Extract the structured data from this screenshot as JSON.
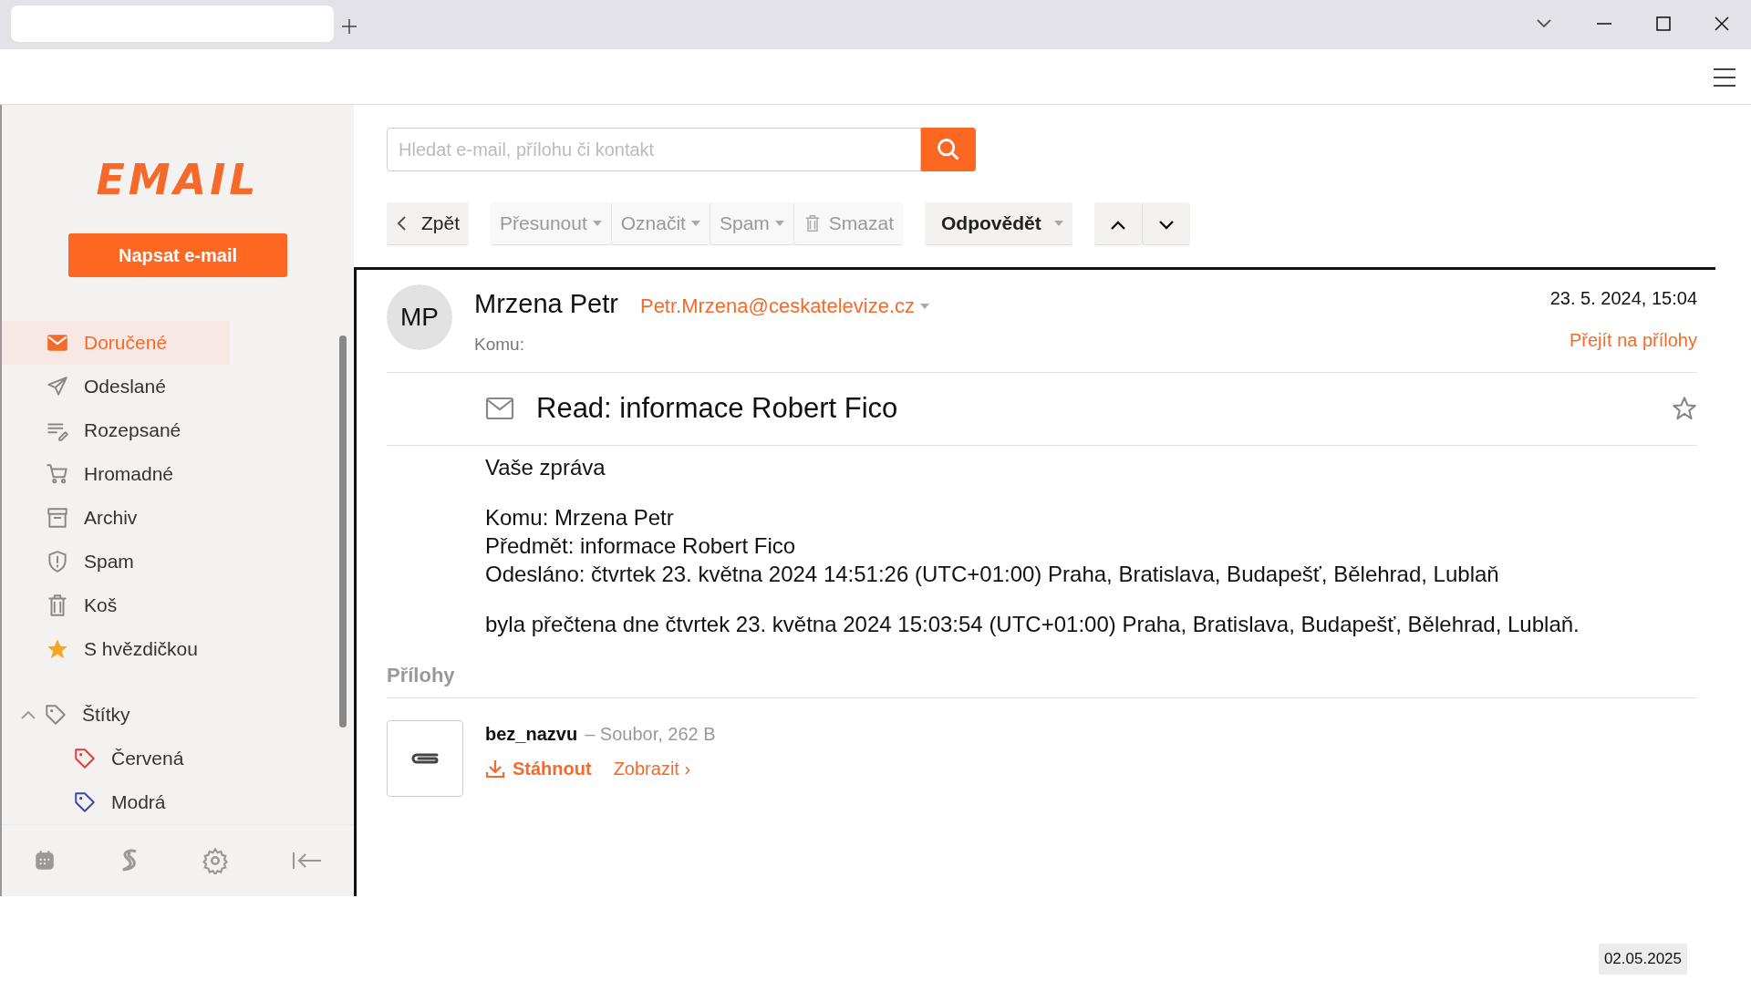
{
  "logo": "EMAIL",
  "compose_button": "Napsat e-mail",
  "folders": [
    {
      "label": "Doručené",
      "selected": true
    },
    {
      "label": "Odeslané",
      "selected": false
    },
    {
      "label": "Rozepsané",
      "selected": false
    },
    {
      "label": "Hromadné",
      "selected": false
    },
    {
      "label": "Archiv",
      "selected": false
    },
    {
      "label": "Spam",
      "selected": false
    },
    {
      "label": "Koš",
      "selected": false
    },
    {
      "label": "S hvězdičkou",
      "selected": false
    }
  ],
  "tags": {
    "label": "Štítky",
    "expanded": true,
    "children": [
      {
        "label": "Červená",
        "color": "#e53935"
      },
      {
        "label": "Modrá",
        "color": "#3949ab"
      }
    ]
  },
  "search": {
    "placeholder": "Hledat e-mail, přílohu či kontakt"
  },
  "toolbar": {
    "back": "Zpět",
    "actions": [
      {
        "label": "Přesunout",
        "disabled": true,
        "dropdown": true
      },
      {
        "label": "Označit",
        "disabled": true,
        "dropdown": true
      },
      {
        "label": "Spam",
        "disabled": true,
        "dropdown": true
      },
      {
        "label": "Smazat",
        "disabled": true,
        "dropdown": false
      }
    ],
    "reply": "Odpovědět"
  },
  "message": {
    "avatar": "MP",
    "sender": "Mrzena Petr",
    "email": "Petr.Mrzena@ceskatelevize.cz",
    "to_label": "Komu:",
    "date": "23. 5. 2024, 15:04",
    "attachments_link": "Přejít na přílohy",
    "subject": "Read: informace Robert Fico",
    "starred": false,
    "body": [
      [
        "Vaše zpráva"
      ],
      [
        "Komu: Mrzena Petr",
        "Předmět: informace Robert Fico",
        "Odesláno: čtvrtek 23. května 2024 14:51:26 (UTC+01:00) Praha, Bratislava, Budapešť, Bělehrad, Lublaň"
      ],
      [
        "byla přečtena dne čtvrtek 23. května 2024 15:03:54 (UTC+01:00) Praha, Bratislava, Budapešť, Bělehrad, Lublaň."
      ]
    ]
  },
  "attachments": {
    "title": "Přílohy",
    "items": [
      {
        "name": "bez_nazvu",
        "meta": "– Soubor, 262 B",
        "download": "Stáhnout",
        "view": "Zobrazit ›"
      }
    ]
  },
  "date_stamp": "02.05.2025"
}
